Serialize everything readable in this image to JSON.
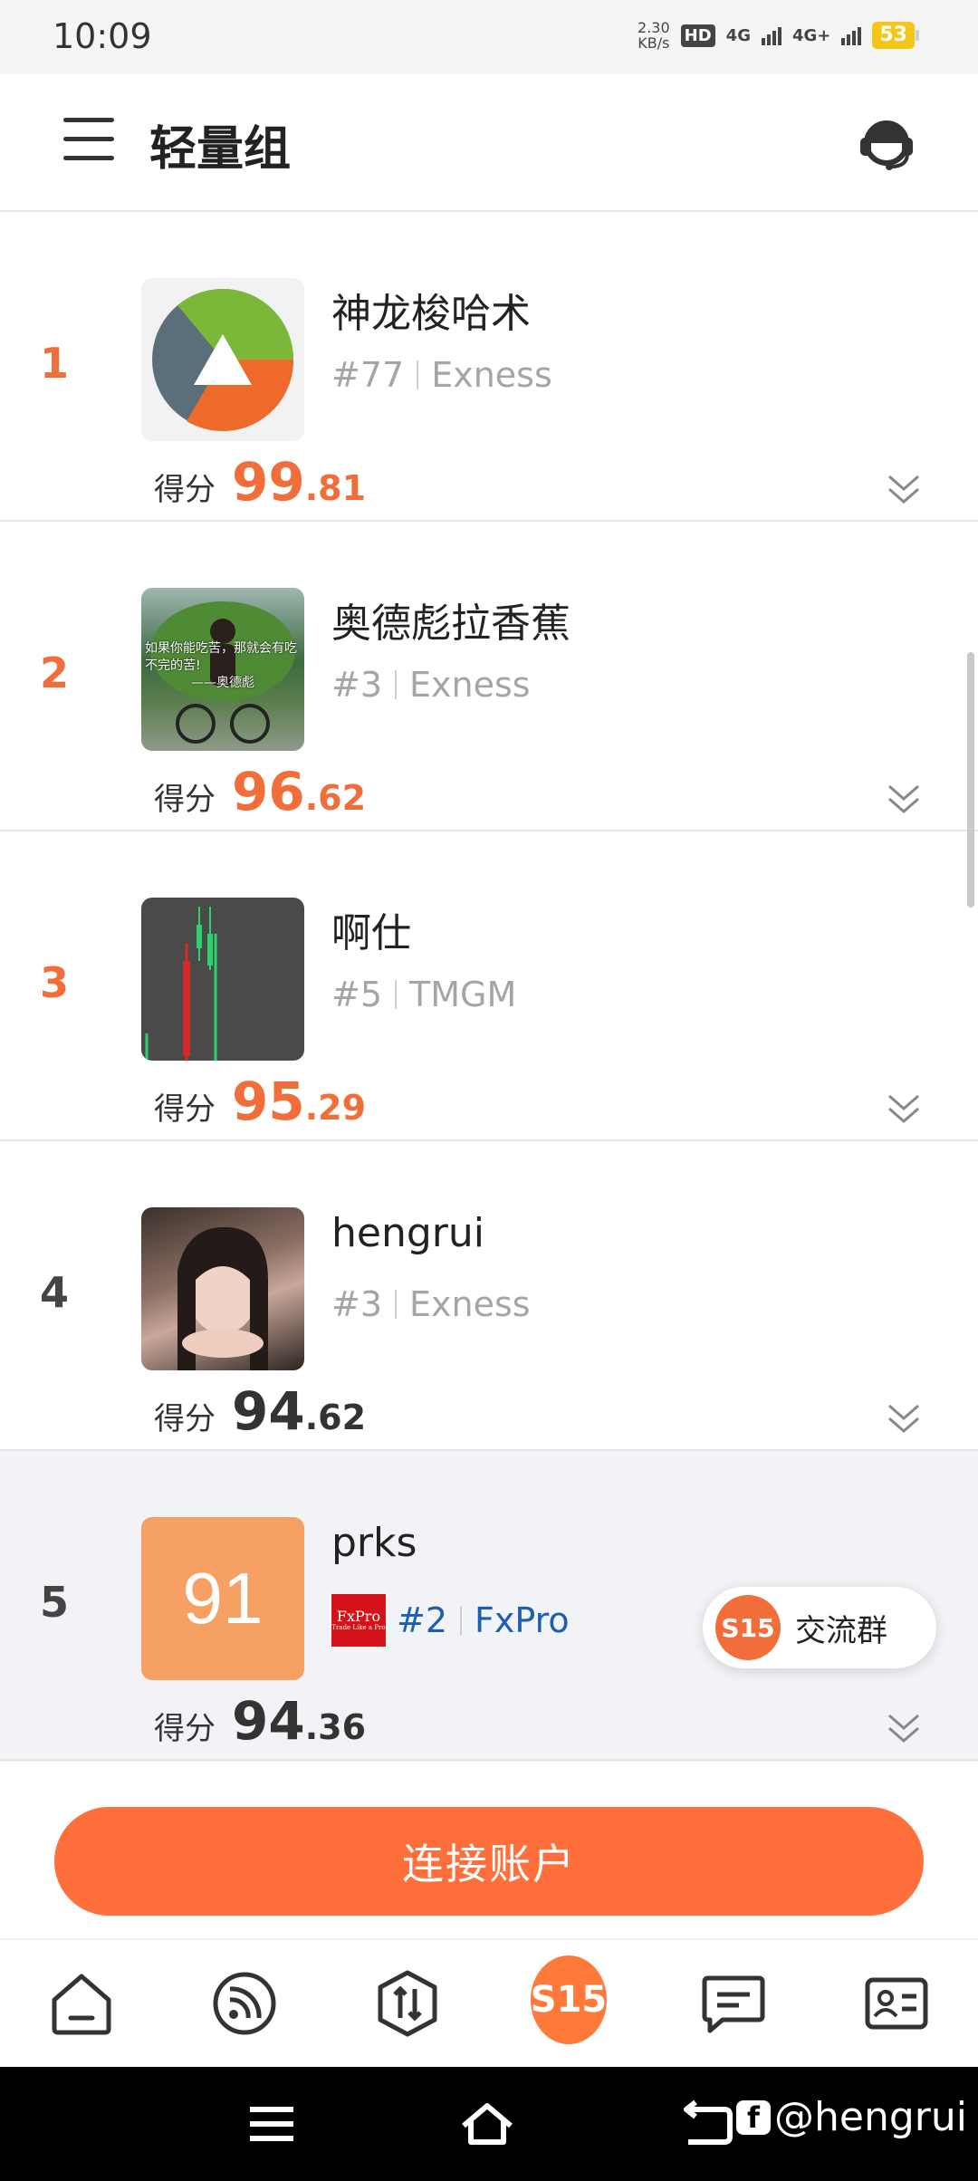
{
  "status_bar": {
    "time": "10:09",
    "net_speed_value": "2.30",
    "net_speed_unit": "KB/s",
    "hd_label": "HD",
    "network_1": "4G",
    "network_2": "4G+",
    "battery": "53",
    "battery_color": "#f5c518"
  },
  "header": {
    "title": "轻量组",
    "menu_icon": "hamburger-menu-icon",
    "support_icon": "headset-icon"
  },
  "list": {
    "score_label": "得分",
    "rows": [
      {
        "rank": "1",
        "name": "神龙梭哈术",
        "account": "#77",
        "broker": "Exness",
        "score_int": "99",
        "score_dec": ".81",
        "avatar": "pie-logo"
      },
      {
        "rank": "2",
        "name": "奥德彪拉香蕉",
        "account": "#3",
        "broker": "Exness",
        "score_int": "96",
        "score_dec": ".62",
        "avatar": "banana-cyclist-photo",
        "avatar_caption_1": "如果你能吃苦，那就会有吃",
        "avatar_caption_2": "不完的苦!",
        "avatar_caption_3": "——奥德彪"
      },
      {
        "rank": "3",
        "name": "啊仕",
        "account": "#5",
        "broker": "TMGM",
        "score_int": "95",
        "score_dec": ".29",
        "avatar": "candlestick-chart-thumbnail"
      },
      {
        "rank": "4",
        "name": "hengrui",
        "account": "#3",
        "broker": "Exness",
        "score_int": "94",
        "score_dec": ".62",
        "avatar": "portrait-photo"
      },
      {
        "rank": "5",
        "name": "prks",
        "account": "#2",
        "broker": "FxPro",
        "score_int": "94",
        "score_dec": ".36",
        "avatar_text": "91",
        "avatar_color": "#f7a064",
        "broker_logo_text": "FxPro",
        "broker_logo_tagline": "Trade Like a Pro"
      }
    ]
  },
  "floating_chat": {
    "logo": "S15",
    "label": "交流群"
  },
  "cta": {
    "label": "连接账户",
    "color": "#ff6f3c"
  },
  "tab_bar": {
    "tabs": [
      {
        "icon": "home-icon"
      },
      {
        "icon": "feed-icon"
      },
      {
        "icon": "trade-icon"
      },
      {
        "icon": "s15-logo-icon",
        "label": "S15"
      },
      {
        "icon": "messages-icon"
      },
      {
        "icon": "profile-card-icon"
      }
    ]
  },
  "system_nav": {
    "watermark": "@hengrui",
    "watermark_badge": "f"
  },
  "colors": {
    "accent": "#f16e3b",
    "text": "#222222",
    "muted": "#a5a5a5",
    "link": "#1a5fb4"
  }
}
